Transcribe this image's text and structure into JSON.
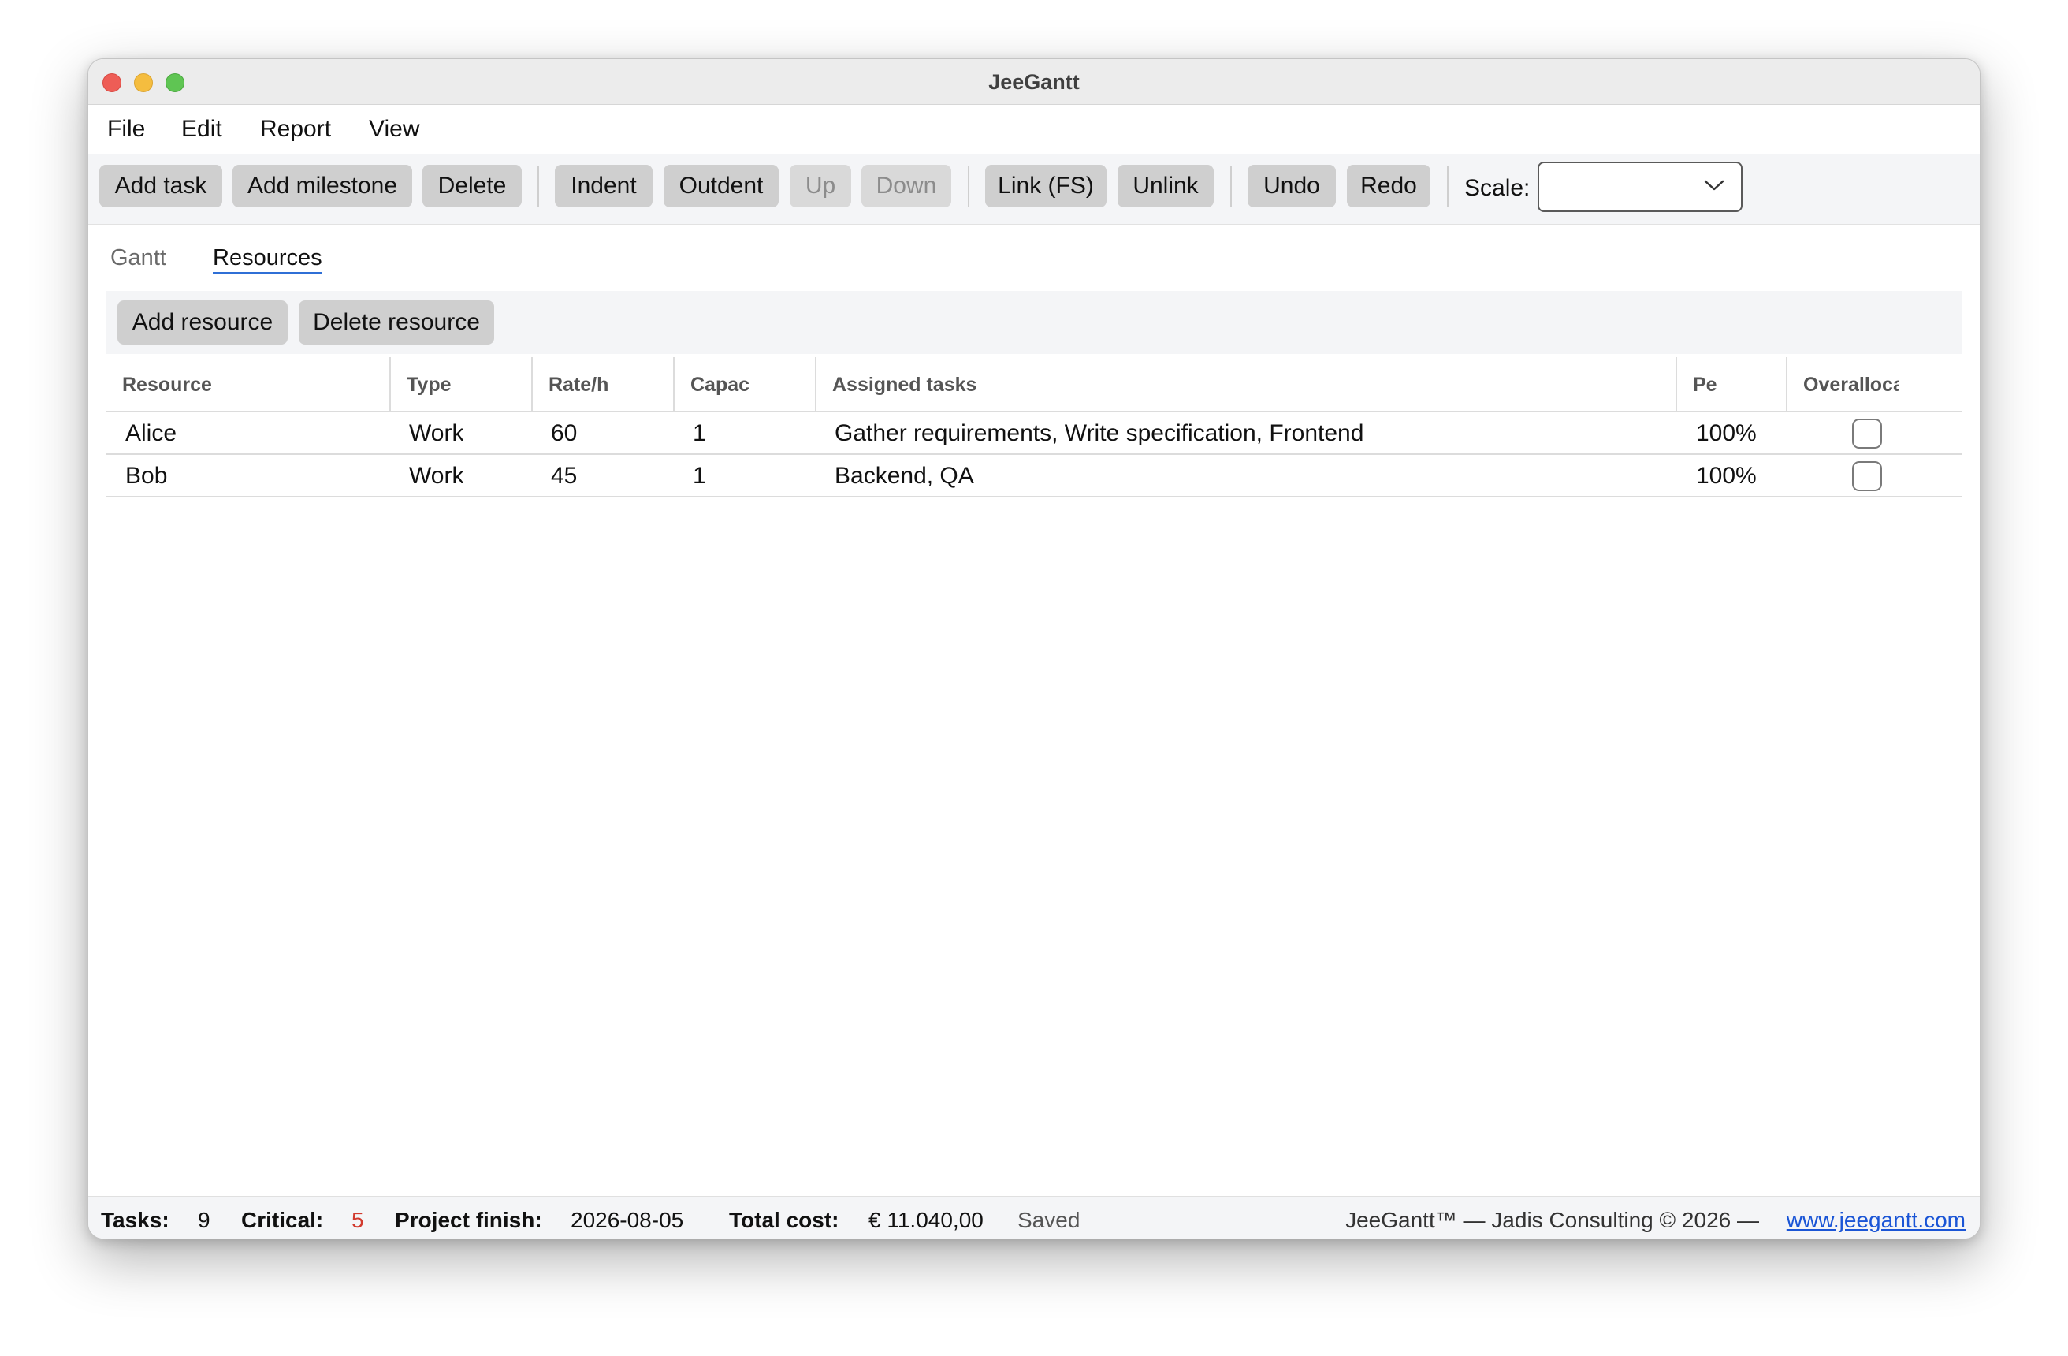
{
  "window": {
    "title": "JeeGantt"
  },
  "menu": [
    "File",
    "Edit",
    "Report",
    "View"
  ],
  "toolbar": {
    "add_task": "Add task",
    "add_milestone": "Add milestone",
    "delete": "Delete",
    "indent": "Indent",
    "outdent": "Outdent",
    "up": "Up",
    "down": "Down",
    "link": "Link (FS)",
    "unlink": "Unlink",
    "undo": "Undo",
    "redo": "Redo",
    "scale_label": "Scale:",
    "scale_value": ""
  },
  "tabs": [
    {
      "label": "Gantt",
      "active": false
    },
    {
      "label": "Resources",
      "active": true
    }
  ],
  "resources_toolbar": {
    "add_resource": "Add resource",
    "delete_resource": "Delete resource"
  },
  "table": {
    "columns": [
      "Resource",
      "Type",
      "Rate/h",
      "Capac",
      "Assigned tasks",
      "Pe",
      "Overalloca"
    ],
    "rows": [
      {
        "resource": "Alice",
        "type": "Work",
        "rate": "60",
        "capacity": "1",
        "tasks": "Gather requirements, Write specification, Frontend",
        "peak": "100%",
        "overallocated": false
      },
      {
        "resource": "Bob",
        "type": "Work",
        "rate": "45",
        "capacity": "1",
        "tasks": "Backend, QA",
        "peak": "100%",
        "overallocated": false
      }
    ]
  },
  "status": {
    "tasks_label": "Tasks:",
    "tasks_value": "9",
    "critical_label": "Critical:",
    "critical_value": "5",
    "finish_label": "Project finish:",
    "finish_value": "2026-08-05",
    "cost_label": "Total cost:",
    "cost_value": "€ 11.040,00",
    "saved": "Saved",
    "footer_text": "JeeGantt™ — Jadis Consulting © 2026 —",
    "footer_link": "www.jeegantt.com"
  },
  "colors": {
    "accent": "#2f6fd6",
    "critical": "#d23a2e",
    "link": "#1a55d6",
    "button": "#cfcfcf"
  }
}
